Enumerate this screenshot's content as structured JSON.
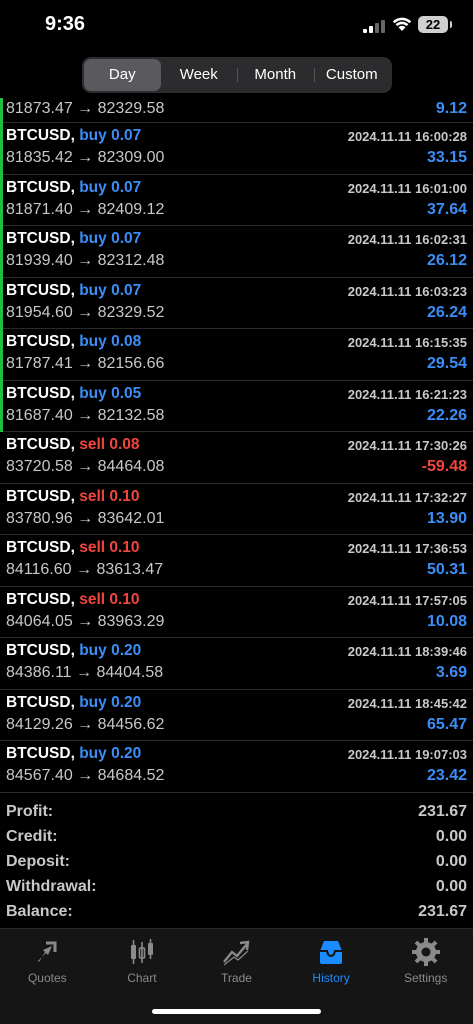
{
  "status": {
    "time": "9:36",
    "battery": "22"
  },
  "tabs_period": [
    "Day",
    "Week",
    "Month",
    "Custom"
  ],
  "deals": [
    {
      "symbol": "",
      "side": "",
      "volume": "",
      "time": "",
      "prices": "81873.47 → 82329.58",
      "profit": "9.12"
    },
    {
      "symbol": "BTCUSD,",
      "side": "buy",
      "volume": "0.07",
      "time": "2024.11.11 16:00:28",
      "prices": "81835.42 → 82309.00",
      "profit": "33.15"
    },
    {
      "symbol": "BTCUSD,",
      "side": "buy",
      "volume": "0.07",
      "time": "2024.11.11 16:01:00",
      "prices": "81871.40 → 82409.12",
      "profit": "37.64"
    },
    {
      "symbol": "BTCUSD,",
      "side": "buy",
      "volume": "0.07",
      "time": "2024.11.11 16:02:31",
      "prices": "81939.40 → 82312.48",
      "profit": "26.12"
    },
    {
      "symbol": "BTCUSD,",
      "side": "buy",
      "volume": "0.07",
      "time": "2024.11.11 16:03:23",
      "prices": "81954.60 → 82329.52",
      "profit": "26.24"
    },
    {
      "symbol": "BTCUSD,",
      "side": "buy",
      "volume": "0.08",
      "time": "2024.11.11 16:15:35",
      "prices": "81787.41 → 82156.66",
      "profit": "29.54"
    },
    {
      "symbol": "BTCUSD,",
      "side": "buy",
      "volume": "0.05",
      "time": "2024.11.11 16:21:23",
      "prices": "81687.40 → 82132.58",
      "profit": "22.26"
    },
    {
      "symbol": "BTCUSD,",
      "side": "sell",
      "volume": "0.08",
      "time": "2024.11.11 17:30:26",
      "prices": "83720.58 → 84464.08",
      "profit": "-59.48"
    },
    {
      "symbol": "BTCUSD,",
      "side": "sell",
      "volume": "0.10",
      "time": "2024.11.11 17:32:27",
      "prices": "83780.96 → 83642.01",
      "profit": "13.90"
    },
    {
      "symbol": "BTCUSD,",
      "side": "sell",
      "volume": "0.10",
      "time": "2024.11.11 17:36:53",
      "prices": "84116.60 → 83613.47",
      "profit": "50.31"
    },
    {
      "symbol": "BTCUSD,",
      "side": "sell",
      "volume": "0.10",
      "time": "2024.11.11 17:57:05",
      "prices": "84064.05 → 83963.29",
      "profit": "10.08"
    },
    {
      "symbol": "BTCUSD,",
      "side": "buy",
      "volume": "0.20",
      "time": "2024.11.11 18:39:46",
      "prices": "84386.11 → 84404.58",
      "profit": "3.69"
    },
    {
      "symbol": "BTCUSD,",
      "side": "buy",
      "volume": "0.20",
      "time": "2024.11.11 18:45:42",
      "prices": "84129.26 → 84456.62",
      "profit": "65.47"
    },
    {
      "symbol": "BTCUSD,",
      "side": "buy",
      "volume": "0.20",
      "time": "2024.11.11 19:07:03",
      "prices": "84567.40 → 84684.52",
      "profit": "23.42"
    }
  ],
  "summary": [
    {
      "label": "Profit:",
      "value": "231.67"
    },
    {
      "label": "Credit:",
      "value": "0.00"
    },
    {
      "label": "Deposit:",
      "value": "0.00"
    },
    {
      "label": "Withdrawal:",
      "value": "0.00"
    },
    {
      "label": "Balance:",
      "value": "231.67"
    }
  ],
  "bottom_tabs": [
    {
      "label": "Quotes",
      "icon": "quotes-icon"
    },
    {
      "label": "Chart",
      "icon": "chart-icon"
    },
    {
      "label": "Trade",
      "icon": "trade-icon"
    },
    {
      "label": "History",
      "icon": "history-icon",
      "active": true
    },
    {
      "label": "Settings",
      "icon": "settings-icon"
    }
  ],
  "colors": {
    "buy": "#3b8ef7",
    "sell": "#f2453d",
    "accent": "#1a8cff",
    "open_marker": "#1fbf3f"
  }
}
